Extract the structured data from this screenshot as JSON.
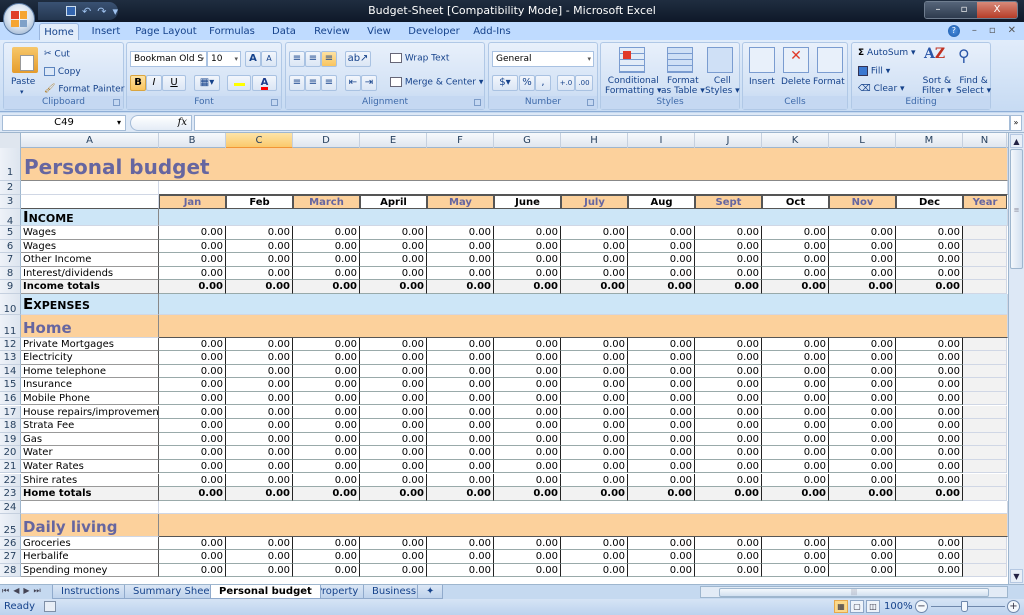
{
  "window": {
    "title": "Budget-Sheet  [Compatibility Mode] - Microsoft Excel",
    "controls": {
      "minimize": "–",
      "restore": "▫",
      "close": "X"
    }
  },
  "quick_access": {
    "save_icon": "💾",
    "undo_icon": "↶",
    "redo_icon": "↷",
    "customize_icon": "▾"
  },
  "ribbon_tabs": [
    "Home",
    "Insert",
    "Page Layout",
    "Formulas",
    "Data",
    "Review",
    "View",
    "Developer",
    "Add-Ins"
  ],
  "active_tab": "Home",
  "mdi": {
    "help": "?",
    "minimize": "–",
    "restore": "▫",
    "close": "✕"
  },
  "ribbon": {
    "clipboard": {
      "label": "Clipboard",
      "paste": "Paste",
      "cut": "Cut",
      "copy": "Copy",
      "format_painter": "Format Painter"
    },
    "font": {
      "label": "Font",
      "font_name": "Bookman Old S",
      "font_size": "10",
      "grow": "A",
      "shrink": "A",
      "bold": "B",
      "italic": "I",
      "underline": "U",
      "highlight_color": "#ffff00",
      "font_color": "#ff0000"
    },
    "alignment": {
      "label": "Alignment",
      "wrap_text": "Wrap Text",
      "merge_center": "Merge & Center"
    },
    "number": {
      "label": "Number",
      "format": "General",
      "percent": "%",
      "comma": ",",
      "inc_decimal": "+.0",
      "dec_decimal": ".00"
    },
    "styles": {
      "label": "Styles",
      "conditional": [
        "Conditional",
        "Formatting ▾"
      ],
      "format_table": [
        "Format",
        "as Table ▾"
      ],
      "cell_styles": [
        "Cell",
        "Styles ▾"
      ]
    },
    "cells": {
      "label": "Cells",
      "insert": "Insert",
      "delete": "Delete",
      "format": "Format"
    },
    "editing": {
      "label": "Editing",
      "autosum": "AutoSum ▾",
      "fill": "Fill ▾",
      "clear": "Clear ▾",
      "sort_filter": [
        "Sort &",
        "Filter ▾"
      ],
      "find_select": [
        "Find &",
        "Select ▾"
      ]
    }
  },
  "formula_bar": {
    "name_box": "C49",
    "fx": "fx",
    "formula": ""
  },
  "columns": [
    "A",
    "B",
    "C",
    "D",
    "E",
    "F",
    "G",
    "H",
    "I",
    "J",
    "K",
    "L",
    "M",
    "N"
  ],
  "selected_column": "C",
  "sheet": {
    "title": "Personal budget",
    "months": [
      "Jan",
      "Feb",
      "March",
      "April",
      "May",
      "June",
      "July",
      "Aug",
      "Sept",
      "Oct",
      "Nov",
      "Dec",
      "Year"
    ],
    "income_header": "Income",
    "income_items": [
      "Wages",
      "Wages",
      "Other Income",
      "Interest/dividends"
    ],
    "income_total_label": "Income totals",
    "expenses_header": "Expenses",
    "home_header": "Home",
    "home_items": [
      "Private Mortgages",
      "Electricity",
      "Home telephone",
      "Insurance",
      "Mobile Phone",
      "House repairs/improvements",
      "Strata Fee",
      "Gas",
      "Water",
      "Water Rates",
      "Shire rates"
    ],
    "home_total_label": "Home totals",
    "daily_header": "Daily living",
    "daily_items": [
      "Groceries",
      "Herbalife",
      "Spending money"
    ],
    "value": "0.00",
    "colors": {
      "peach": "#fcd19c",
      "light_blue": "#cde6f7",
      "title_purple": "#6666a0",
      "total_gray": "#f2f2f2"
    }
  },
  "rows": [
    "1",
    "2",
    "3",
    "4",
    "5",
    "6",
    "7",
    "8",
    "9",
    "10",
    "11",
    "12",
    "13",
    "14",
    "15",
    "16",
    "17",
    "18",
    "19",
    "20",
    "21",
    "22",
    "23",
    "24",
    "25",
    "26",
    "27",
    "28"
  ],
  "sheet_tabs": [
    "Instructions",
    "Summary Sheet",
    "Personal budget",
    "Property",
    "Business"
  ],
  "active_sheet": "Personal budget",
  "status": {
    "mode": "Ready",
    "zoom": "100%"
  }
}
